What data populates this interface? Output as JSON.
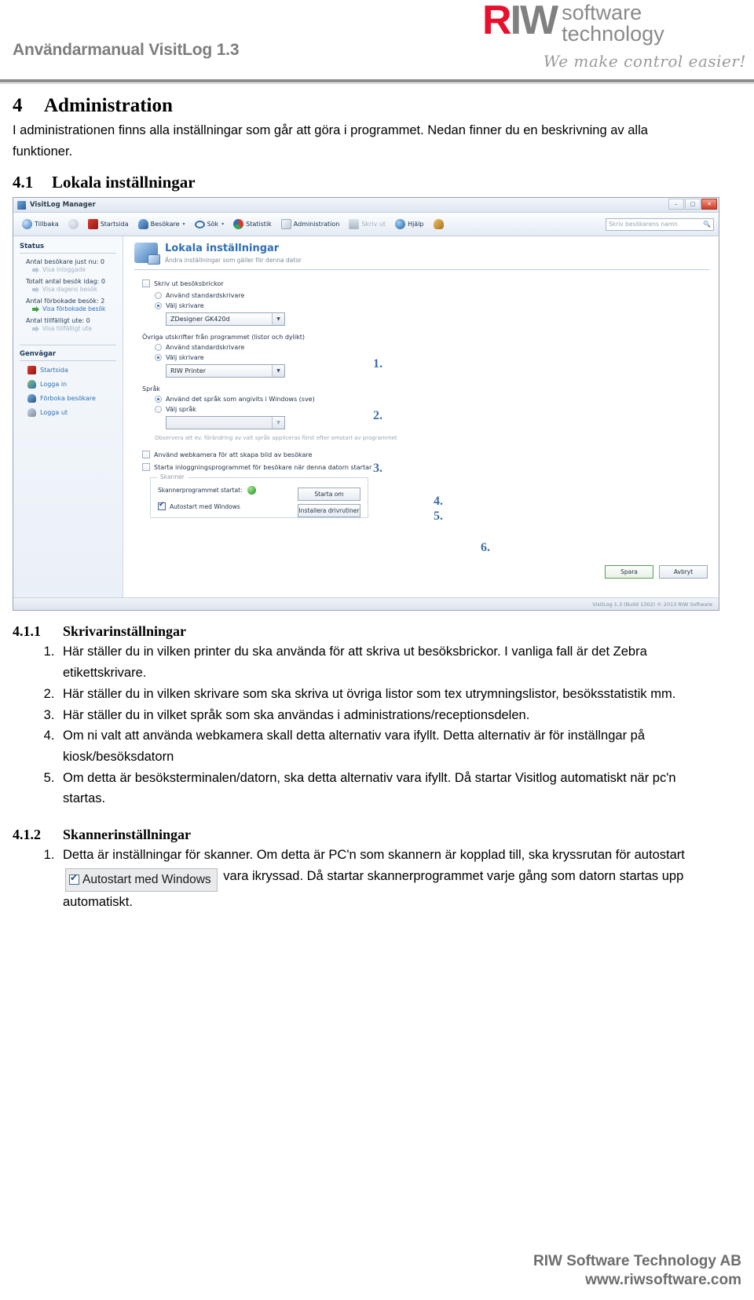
{
  "header": {
    "manual_title": "Användarmanual VisitLog 1.3",
    "logo": {
      "r": "R",
      "iw": "IW",
      "word1": "software",
      "word2": "technology",
      "tagline": "We make control easier!"
    }
  },
  "doc": {
    "section4": {
      "num": "4",
      "title": "Administration"
    },
    "intro": "I administrationen finns alla inställningar som går att göra i programmet. Nedan finner du en beskrivning av alla funktioner.",
    "section41": {
      "num": "4.1",
      "title": "Lokala inställningar"
    },
    "section411": {
      "num": "4.1.1",
      "title": "Skrivarinställningar"
    },
    "list411": [
      "Här ställer du in vilken printer du ska använda för att skriva ut besöksbrickor. I vanliga fall är det  Zebra etikettskrivare.",
      "Här ställer du in vilken skrivare som ska skriva ut övriga listor som tex utrymningslistor, besöksstatistik mm.",
      "Här ställer du in vilket språk som ska användas i administrations/receptionsdelen.",
      "Om ni valt att använda webkamera skall detta alternativ vara ifyllt. Detta alternativ är för inställngar på kiosk/besöksdatorn",
      "Om detta är besöksterminalen/datorn, ska detta alternativ vara ifyllt. Då startar Visitlog automatiskt när pc'n startas."
    ],
    "section412": {
      "num": "4.1.2",
      "title": "Skannerinställningar"
    },
    "list412": {
      "part1": "Detta är inställningar för skanner. Om detta är PC'n som skannern är kopplad till, ska kryssrutan för autostart",
      "inline_checkbox": "Autostart med Windows",
      "part2": "vara ikryssad. Då startar skannerprogrammet varje gång som datorn startas upp automatiskt."
    }
  },
  "app": {
    "window_title": "VisitLog Manager",
    "window_buttons": {
      "minimize": "–",
      "maximize": "□",
      "close": "✕"
    },
    "toolbar": [
      {
        "label": "Tillbaka",
        "icon": "back-arrow-icon",
        "disabled": false,
        "caret": false
      },
      {
        "label": "",
        "icon": "forward-arrow-icon",
        "disabled": true,
        "caret": false
      },
      {
        "label": "Startsida",
        "icon": "home-icon",
        "disabled": false,
        "caret": false
      },
      {
        "label": "Besökare",
        "icon": "visitor-icon",
        "disabled": false,
        "caret": true
      },
      {
        "label": "Sök",
        "icon": "search-icon",
        "disabled": false,
        "caret": true
      },
      {
        "label": "Statistik",
        "icon": "statistics-pie-icon",
        "disabled": false,
        "caret": false
      },
      {
        "label": "Administration",
        "icon": "administration-icon",
        "disabled": false,
        "caret": false
      },
      {
        "label": "Skriv ut",
        "icon": "print-icon",
        "disabled": true,
        "caret": false
      },
      {
        "label": "Hjälp",
        "icon": "help-icon",
        "disabled": false,
        "caret": false
      },
      {
        "label": "",
        "icon": "user-icon",
        "disabled": false,
        "caret": false
      }
    ],
    "search": {
      "placeholder": "Skriv besökarens namn",
      "icon": "search-icon"
    },
    "sidebar": {
      "status_heading": "Status",
      "status_items": [
        {
          "label": "Antal besökare just nu: 0",
          "link": "Visa inloggade",
          "link_active": false
        },
        {
          "label": "Totalt antal besök idag: 0",
          "link": "Visa dagens besök",
          "link_active": false
        },
        {
          "label": "Antal förbokade besök: 2",
          "link": "Visa förbokade besök",
          "link_active": true
        },
        {
          "label": "Antal tillfälligt ute: 0",
          "link": "Visa tillfälligt ute",
          "link_active": false
        }
      ],
      "shortcuts_heading": "Genvägar",
      "shortcuts": [
        {
          "label": "Startsida",
          "icon": "home-icon"
        },
        {
          "label": "Logga in",
          "icon": "login-icon"
        },
        {
          "label": "Förboka besökare",
          "icon": "prebook-icon"
        },
        {
          "label": "Logga ut",
          "icon": "logout-icon"
        }
      ]
    },
    "panel": {
      "title": "Lokala inställningar",
      "subtitle": "Ändra inställningar som gäller för denna dator",
      "icon": "local-settings-icon",
      "print_badges_checkbox": "Skriv ut besöksbrickor",
      "badge_radio_default": "Använd standardskrivare",
      "badge_radio_select": "Välj skrivare",
      "badge_printer_value": "ZDesigner GK420d",
      "other_prints_label": "Övriga utskrifter från programmet (listor och dylikt)",
      "other_radio_default": "Använd standardskrivare",
      "other_radio_select": "Välj skrivare",
      "other_printer_value": "RIW Printer",
      "language_label": "Språk",
      "lang_radio_windows": "Använd det språk som angivits i Windows (sve)",
      "lang_radio_select": "Välj språk",
      "lang_value": "",
      "lang_hint": "Observera att ev. förändring av valt språk appliceras först efter omstart av programmet",
      "webcam_checkbox": "Använd webkamera för att skapa bild av besökare",
      "autostart_checkbox": "Starta inloggningsprogrammet för besökare när denna datorn startar",
      "scanner_legend": "Skanner",
      "scanner_status_label": "Skannerprogrammet startat:",
      "scanner_restart_button": "Starta om",
      "scanner_install_button": "Installera drivrutiner",
      "scanner_autostart_checkbox": "Autostart med Windows",
      "markers": [
        "1.",
        "2.",
        "3.",
        "4.",
        "5.",
        "6."
      ],
      "save_button": "Spara",
      "cancel_button": "Avbryt",
      "statusbar_text": "VisitLog 1.3 (Build 1302)  © 2013 RIW Software"
    }
  },
  "footer": {
    "company": "RIW Software Technology AB",
    "website": "www.riwsoftware.com"
  }
}
